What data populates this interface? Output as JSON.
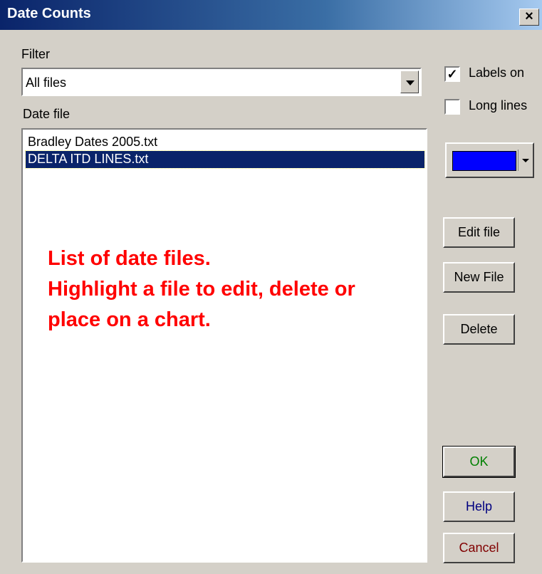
{
  "window": {
    "title": "Date Counts",
    "close_label": "×"
  },
  "filter": {
    "label": "Filter",
    "value": "All files"
  },
  "date_file": {
    "label": "Date file",
    "items": [
      {
        "label": "Bradley Dates 2005.txt",
        "selected": false
      },
      {
        "label": "DELTA ITD LINES.txt",
        "selected": true
      }
    ]
  },
  "annotation": {
    "line1": "List of date files.",
    "line2": "Highlight a file to edit, delete or",
    "line3": "place on a chart.",
    "color": "#ff0000"
  },
  "options": {
    "labels_on": {
      "label": "Labels on",
      "checked": true
    },
    "long_lines": {
      "label": "Long lines",
      "checked": false
    }
  },
  "color_picker": {
    "color": "#0000ff"
  },
  "buttons": {
    "edit_file": "Edit file",
    "new_file": "New File",
    "delete": "Delete",
    "ok": "OK",
    "help": "Help",
    "cancel": "Cancel"
  },
  "button_colors": {
    "ok": "#008000",
    "help": "#000080",
    "cancel": "#800000"
  }
}
